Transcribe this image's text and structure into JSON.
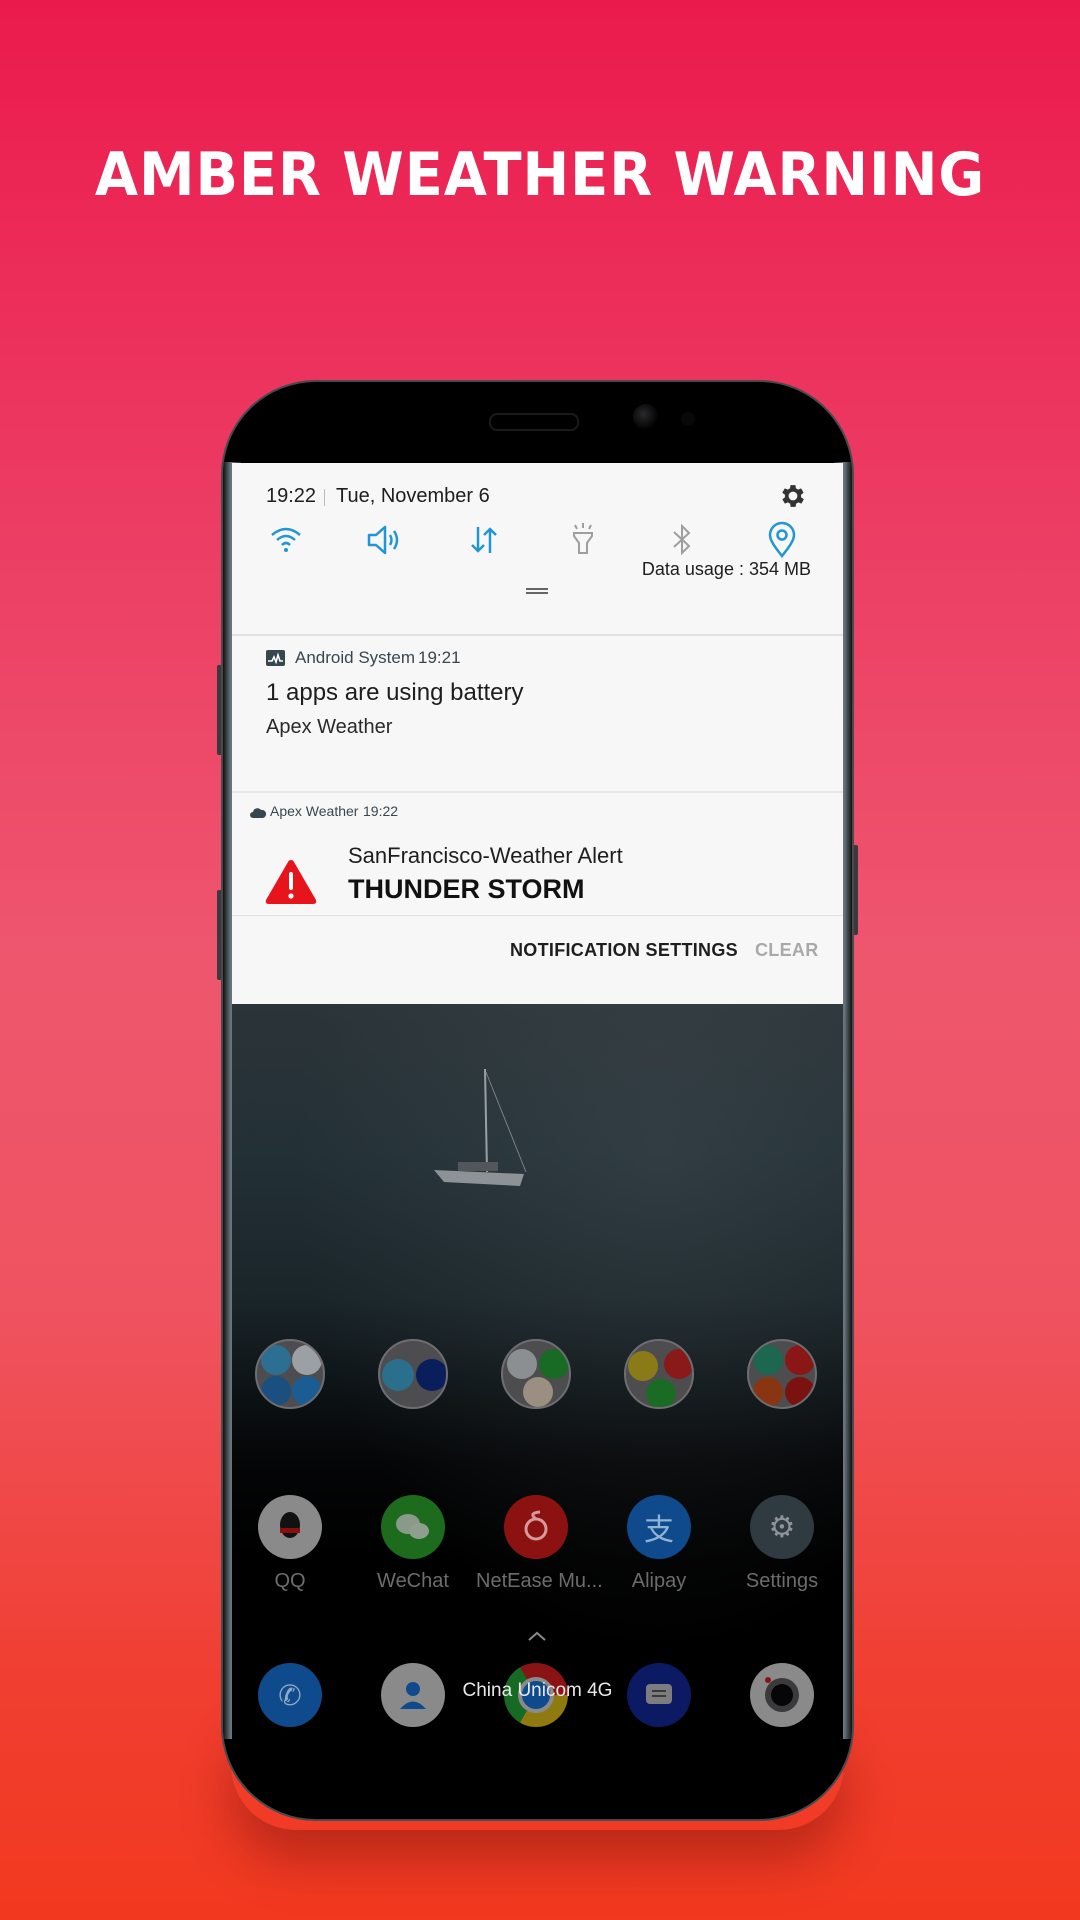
{
  "headline": "AMBER WEATHER WARNING",
  "colors": {
    "bg_top": "#EB1A4D",
    "bg_bottom": "#F2391F",
    "accent_blue": "#2196D3",
    "alert_red": "#E8141B"
  },
  "status": {
    "time": "19:22",
    "date": "Tue, November 6",
    "data_usage": "Data usage : 354 MB"
  },
  "quick_settings": [
    {
      "icon": "wifi-icon",
      "active": true
    },
    {
      "icon": "sound-icon",
      "active": true
    },
    {
      "icon": "mobile-data-icon",
      "active": true
    },
    {
      "icon": "flashlight-icon",
      "active": false
    },
    {
      "icon": "bluetooth-icon",
      "active": false
    },
    {
      "icon": "location-icon",
      "active": true
    }
  ],
  "notifications": [
    {
      "app": "Android System",
      "time": "19:21",
      "title": "1 apps are using battery",
      "text": "Apex Weather",
      "icon": "battery-usage-icon"
    },
    {
      "app": "Apex Weather",
      "time": "19:22",
      "title": "SanFrancisco-Weather Alert",
      "text": "THUNDER STORM",
      "icon": "cloud-icon",
      "large_icon": "warning-triangle-icon"
    }
  ],
  "actions": {
    "settings": "NOTIFICATION SETTINGS",
    "clear": "CLEAR"
  },
  "home": {
    "folders": [
      "google-folder",
      "tools-folder",
      "video-folder",
      "social-folder",
      "shopping-folder"
    ],
    "apps": [
      {
        "label": "QQ",
        "color": "#8a8a8a"
      },
      {
        "label": "WeChat",
        "color": "#1d6b1d"
      },
      {
        "label": "NetEase Mu...",
        "color": "#8c1212"
      },
      {
        "label": "Alipay",
        "color": "#0e4a8c"
      },
      {
        "label": "Settings",
        "color": "#2f3a41"
      }
    ],
    "dock": [
      "phone",
      "contacts",
      "chrome",
      "messages",
      "camera"
    ],
    "carrier": "China Unicom 4G"
  }
}
